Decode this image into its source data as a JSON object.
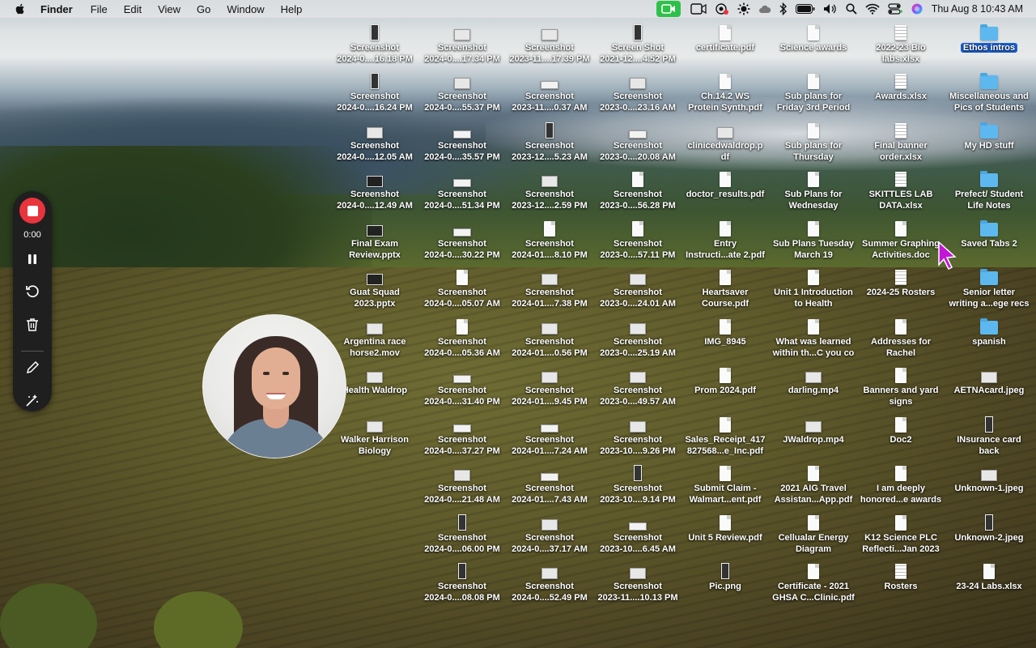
{
  "menubar": {
    "app": "Finder",
    "items": [
      "File",
      "Edit",
      "View",
      "Go",
      "Window",
      "Help"
    ],
    "clock": "Thu Aug 8  10:43 AM",
    "status_icons": [
      "facetime-icon",
      "screen-share-icon",
      "screen-record-icon",
      "brightness-icon",
      "cloud-icon",
      "bluetooth-icon",
      "battery-icon",
      "volume-icon",
      "search-icon",
      "wifi-icon",
      "control-center-icon",
      "siri-icon"
    ]
  },
  "recorder": {
    "time": "0:00",
    "tools": [
      "pause-icon",
      "restart-icon",
      "trash-icon",
      "pen-icon",
      "magic-icon"
    ]
  },
  "desktop": {
    "columns": [
      [
        {
          "label": "Screenshot\n2024-0....16.18 PM",
          "kind": "tall"
        },
        {
          "label": "Screenshot\n2024-0....16.24 PM",
          "kind": "tall"
        },
        {
          "label": "Screenshot\n2024-0....12.05 AM",
          "kind": "thumb"
        },
        {
          "label": "Screenshot\n2024-0....12.49 AM",
          "kind": "dark"
        },
        {
          "label": "Final Exam\nReview.pptx",
          "kind": "dark"
        },
        {
          "label": "Guat Squad\n2023.pptx",
          "kind": "dark"
        },
        {
          "label": "Argentina race\nhorse2.mov",
          "kind": "thumb"
        },
        {
          "label": "Health Waldrop",
          "kind": "thumb"
        },
        {
          "label": "Walker Harrison\nBiology",
          "kind": "thumb"
        }
      ],
      [
        {
          "label": "Screenshot\n2024-0....17.34 PM",
          "kind": "thumb"
        },
        {
          "label": "Screenshot\n2024-0....55.37 PM",
          "kind": "thumb"
        },
        {
          "label": "Screenshot\n2024-0....35.57 PM",
          "kind": "wide"
        },
        {
          "label": "Screenshot\n2024-0....51.34 PM",
          "kind": "wide"
        },
        {
          "label": "Screenshot\n2024-0....30.22 PM",
          "kind": "wide"
        },
        {
          "label": "Screenshot\n2024-0....05.07 AM",
          "kind": "doc"
        },
        {
          "label": "Screenshot\n2024-0....05.36 AM",
          "kind": "doc"
        },
        {
          "label": "Screenshot\n2024-0....31.40 PM",
          "kind": "wide"
        },
        {
          "label": "Screenshot\n2024-0....37.27 PM",
          "kind": "wide"
        },
        {
          "label": "Screenshot\n2024-0....21.48 AM",
          "kind": "thumb"
        },
        {
          "label": "Screenshot\n2024-0....06.00 PM",
          "kind": "tall"
        },
        {
          "label": "Screenshot\n2024-0....08.08 PM",
          "kind": "tall"
        }
      ],
      [
        {
          "label": "Screenshot\n2023-11....17.39 PM",
          "kind": "thumb"
        },
        {
          "label": "Screenshot\n2023-11....0.37 AM",
          "kind": "wide"
        },
        {
          "label": "Screenshot\n2023-12....5.23 AM",
          "kind": "tall"
        },
        {
          "label": "Screenshot\n2023-12....2.59 PM",
          "kind": "thumb"
        },
        {
          "label": "Screenshot\n2024-01....8.10 PM",
          "kind": "doc"
        },
        {
          "label": "Screenshot\n2024-01....7.38 PM",
          "kind": "thumb"
        },
        {
          "label": "Screenshot\n2024-01....0.56 PM",
          "kind": "thumb"
        },
        {
          "label": "Screenshot\n2024-01....9.45 PM",
          "kind": "thumb"
        },
        {
          "label": "Screenshot\n2024-01....7.24 AM",
          "kind": "wide"
        },
        {
          "label": "Screenshot\n2024-01....7.43 AM",
          "kind": "wide"
        },
        {
          "label": "Screenshot\n2024-0....37.17 AM",
          "kind": "thumb"
        },
        {
          "label": "Screenshot\n2024-0....52.49 PM",
          "kind": "thumb"
        }
      ],
      [
        {
          "label": "Screen Shot\n2021-12....4.52 PM",
          "kind": "tall"
        },
        {
          "label": "Screenshot\n2023-0....23.16 AM",
          "kind": "thumb"
        },
        {
          "label": "Screenshot\n2023-0....20.08 AM",
          "kind": "wide"
        },
        {
          "label": "Screenshot\n2023-0....56.28 PM",
          "kind": "doc"
        },
        {
          "label": "Screenshot\n2023-0....57.11 PM",
          "kind": "doc"
        },
        {
          "label": "Screenshot\n2023-0....24.01 AM",
          "kind": "thumb"
        },
        {
          "label": "Screenshot\n2023-0....25.19 AM",
          "kind": "thumb"
        },
        {
          "label": "Screenshot\n2023-0....49.57 AM",
          "kind": "thumb"
        },
        {
          "label": "Screenshot\n2023-10....9.26 PM",
          "kind": "thumb"
        },
        {
          "label": "Screenshot\n2023-10....9.14 PM",
          "kind": "tall"
        },
        {
          "label": "Screenshot\n2023-10....6.45 AM",
          "kind": "wide"
        },
        {
          "label": "Screenshot\n2023-11....10.13 PM",
          "kind": "thumb"
        }
      ],
      [
        {
          "label": "certificate.pdf",
          "kind": "doc"
        },
        {
          "label": "Ch.14.2 WS\nProtein Synth.pdf",
          "kind": "doc"
        },
        {
          "label": "clinicedwaldrop.p\ndf",
          "kind": "thumb"
        },
        {
          "label": "doctor_results.pdf",
          "kind": "doc"
        },
        {
          "label": "Entry\nInstructi...ate 2.pdf",
          "kind": "doc"
        },
        {
          "label": "Heartsaver\nCourse.pdf",
          "kind": "doc"
        },
        {
          "label": "IMG_8945",
          "kind": "doc"
        },
        {
          "label": "Prom 2024.pdf",
          "kind": "doc"
        },
        {
          "label": "Sales_Receipt_417\n827568...e_Inc.pdf",
          "kind": "doc"
        },
        {
          "label": "Submit Claim -\nWalmart...ent.pdf",
          "kind": "doc"
        },
        {
          "label": "Unit 5 Review.pdf",
          "kind": "doc"
        },
        {
          "label": "Pic.png",
          "kind": "tall"
        }
      ],
      [
        {
          "label": "Science awards",
          "kind": "doc"
        },
        {
          "label": "Sub plans for\nFriday 3rd Period",
          "kind": "doc"
        },
        {
          "label": "Sub plans for\nThursday",
          "kind": "doc"
        },
        {
          "label": "Sub Plans for\nWednesday",
          "kind": "doc"
        },
        {
          "label": "Sub Plans Tuesday\nMarch 19",
          "kind": "doc"
        },
        {
          "label": "Unit 1 Introduction\nto Health",
          "kind": "doc"
        },
        {
          "label": "What was learned\nwithin th...C you co",
          "kind": "doc"
        },
        {
          "label": "darling.mp4",
          "kind": "thumb"
        },
        {
          "label": "JWaldrop.mp4",
          "kind": "thumb"
        },
        {
          "label": "2021 AIG Travel\nAssistan...App.pdf",
          "kind": "doc"
        },
        {
          "label": "Cellualar Energy\nDiagram",
          "kind": "doc"
        },
        {
          "label": "Certificate - 2021\nGHSA C...Clinic.pdf",
          "kind": "doc"
        }
      ],
      [
        {
          "label": "2022-23 Bio\nlabs.xlsx",
          "kind": "sheet"
        },
        {
          "label": "Awards.xlsx",
          "kind": "sheet"
        },
        {
          "label": "Final banner\norder.xlsx",
          "kind": "sheet"
        },
        {
          "label": "SKITTLES LAB\nDATA.xlsx",
          "kind": "sheet"
        },
        {
          "label": "Summer Graphing\nActivities.doc",
          "kind": "doc"
        },
        {
          "label": "2024-25 Rosters",
          "kind": "sheet"
        },
        {
          "label": "Addresses for\nRachel",
          "kind": "doc"
        },
        {
          "label": "Banners and yard\nsigns",
          "kind": "doc"
        },
        {
          "label": "Doc2",
          "kind": "doc"
        },
        {
          "label": "I am deeply\nhonored...e awards",
          "kind": "doc"
        },
        {
          "label": "K12 Science PLC\nReflecti...Jan 2023",
          "kind": "doc"
        },
        {
          "label": "Rosters",
          "kind": "sheet"
        }
      ],
      [
        {
          "label": "Ethos intros",
          "kind": "folder",
          "selected": true
        },
        {
          "label": "Miscellaneous and\nPics of Students",
          "kind": "folder"
        },
        {
          "label": "My HD stuff",
          "kind": "folder"
        },
        {
          "label": "Prefect/ Student\nLife Notes",
          "kind": "folder"
        },
        {
          "label": "Saved Tabs 2",
          "kind": "folder"
        },
        {
          "label": "Senior letter\nwriting a...ege recs",
          "kind": "folder"
        },
        {
          "label": "spanish",
          "kind": "folder"
        },
        {
          "label": "AETNAcard.jpeg",
          "kind": "thumb"
        },
        {
          "label": "INsurance card\nback",
          "kind": "tall"
        },
        {
          "label": "Unknown-1.jpeg",
          "kind": "thumb"
        },
        {
          "label": "Unknown-2.jpeg",
          "kind": "tall"
        },
        {
          "label": "23-24 Labs.xlsx",
          "kind": "doc"
        }
      ]
    ]
  }
}
